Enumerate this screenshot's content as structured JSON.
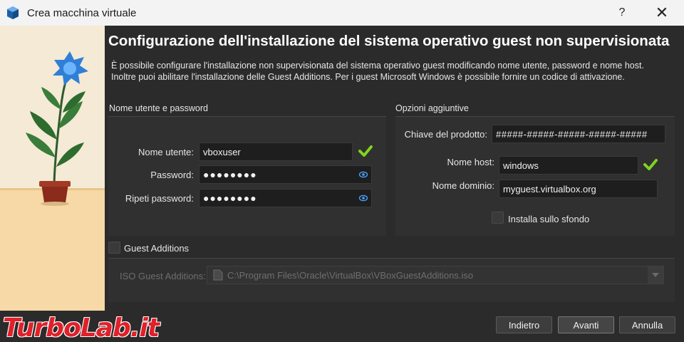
{
  "window": {
    "title": "Crea macchina virtuale",
    "help_label": "?",
    "close_label": "✕"
  },
  "page": {
    "heading": "Configurazione dell'installazione del sistema operativo guest non supervisionata",
    "description_line1": "È possibile configurare l'installazione non supervisionata del sistema operativo guest modificando nome utente, password e nome host.",
    "description_line2": "Inoltre puoi abilitare l'installazione delle Guest Additions. Per i guest Microsoft Windows è possibile fornire un codice di attivazione."
  },
  "user_group": {
    "title": "Nome utente e password",
    "username_label": "Nome utente:",
    "username_value": "vboxuser",
    "password_label": "Password:",
    "password_value": "●●●●●●●●",
    "repeat_label": "Ripeti password:",
    "repeat_value": "●●●●●●●●"
  },
  "options_group": {
    "title": "Opzioni aggiuntive",
    "product_key_label": "Chiave del prodotto:",
    "product_key_value": "#####-#####-#####-#####-#####",
    "hostname_label": "Nome host:",
    "hostname_value": "windows",
    "domain_label": "Nome dominio:",
    "domain_value": "myguest.virtualbox.org",
    "background_label": "Installa sullo sfondo"
  },
  "guest_additions": {
    "label": "Guest Additions",
    "iso_label": "ISO Guest Additions:",
    "iso_value": "C:\\Program Files\\Oracle\\VirtualBox\\VBoxGuestAdditions.iso"
  },
  "buttons": {
    "back": "Indietro",
    "next": "Avanti",
    "cancel": "Annulla"
  },
  "watermark": {
    "text": "TurboLab.it"
  },
  "colors": {
    "accent_check": "#7ed321",
    "eye": "#4aa3ff",
    "flower": "#2f7fd8",
    "watermark": "#e0202a"
  }
}
